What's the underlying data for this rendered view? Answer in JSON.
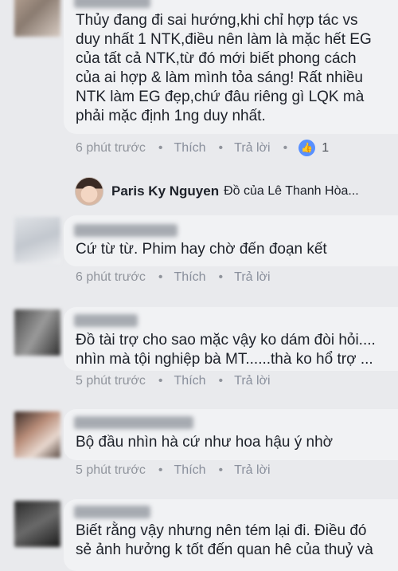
{
  "comments": [
    {
      "text": "Thủy đang đi sai hướng,khi chỉ hợp tác vs\nduy nhất 1 NTK,điều nên làm là mặc hết EG\ncủa tất cả NTK,từ đó mới biết phong cách\ncủa ai hợp & làm mình tỏa sáng! Rất nhiều\nNTK làm EG đẹp,chứ đâu riêng gì LQK mà\nphải mặc định 1ng duy nhất.",
      "time": "6 phút trước",
      "like": "Thích",
      "reply": "Trả lời",
      "like_count": "1"
    },
    {
      "text": "Cứ từ từ. Phim hay chờ đến đoạn kết",
      "time": "6 phút trước",
      "like": "Thích",
      "reply": "Trả lời"
    },
    {
      "text": "Đồ tài trợ cho sao mặc vậy ko dám đòi hỏi....\nnhìn mà tội nghiệp bà MT......thà ko hổ trợ ...",
      "time": "5 phút trước",
      "like": "Thích",
      "reply": "Trả lời"
    },
    {
      "text": "Bộ đầu nhìn hà cứ như hoa hậu ý nhờ",
      "time": "5 phút trước",
      "like": "Thích",
      "reply": "Trả lời"
    },
    {
      "text": "Biết rằng vậy nhưng nên tém lại đi. Điều đó\nsẻ ảnh hưởng k tốt đến quan hê của thuỷ và"
    }
  ],
  "reply_preview": {
    "name": "Paris Ky Nguyen",
    "text": "Đồ của Lê Thanh Hòa..."
  },
  "separator": "•",
  "icons": {
    "like": "thumbs-up-icon",
    "like_color": "#5890ff"
  }
}
